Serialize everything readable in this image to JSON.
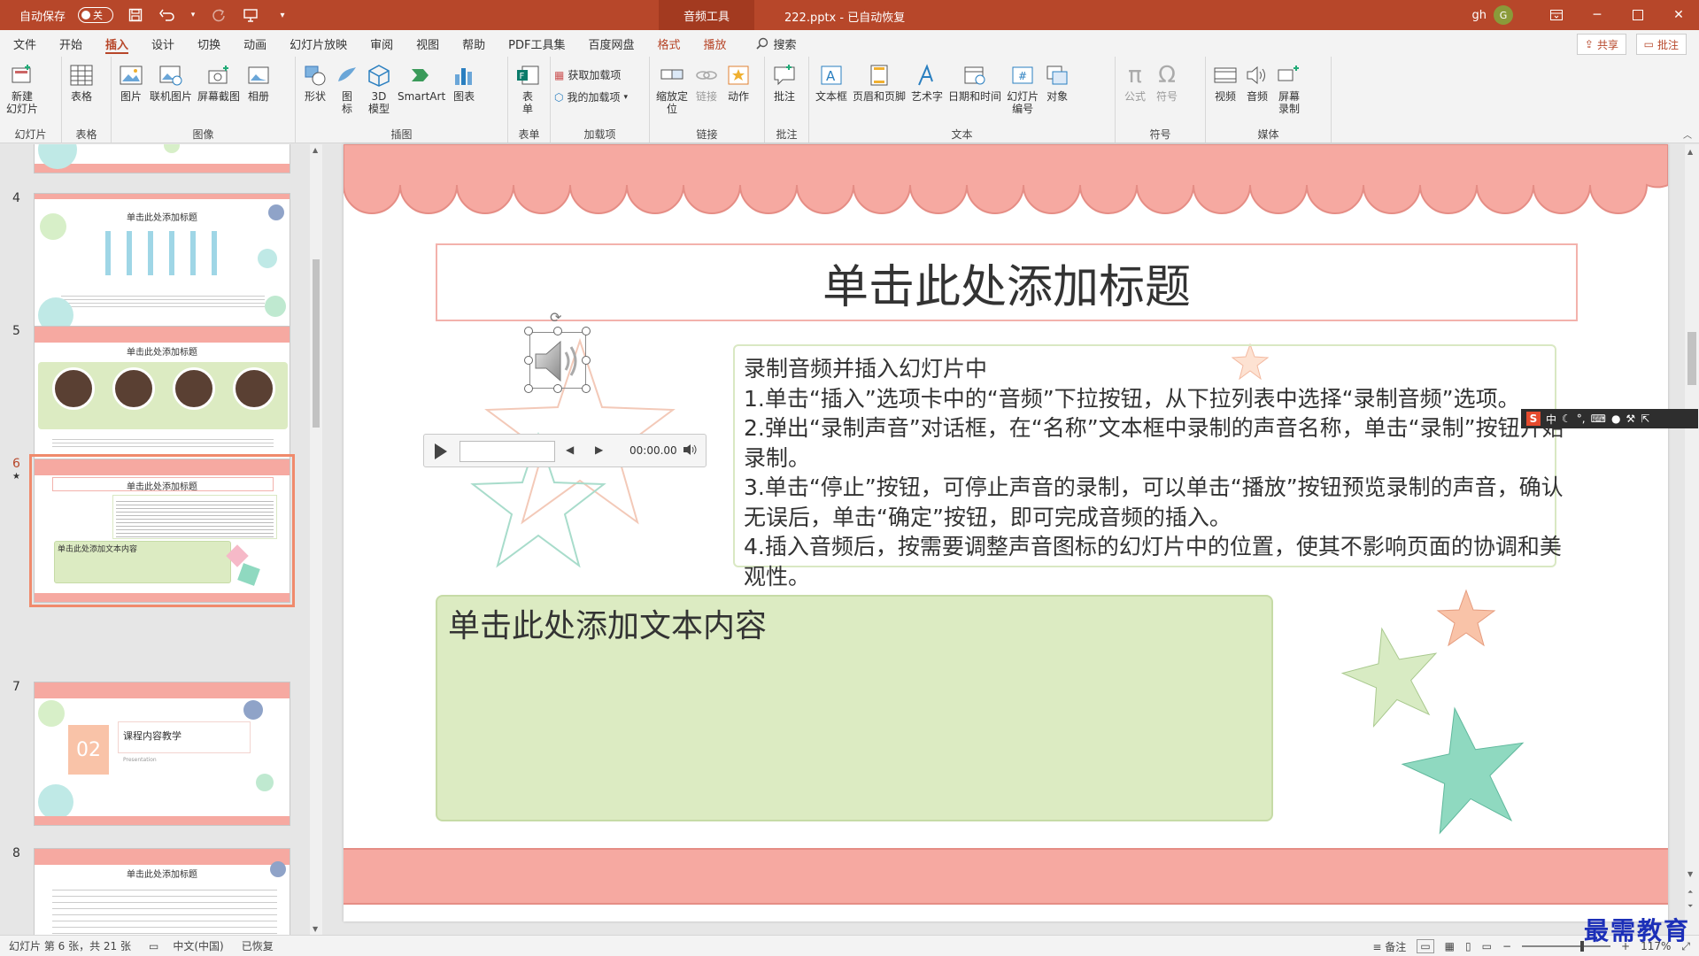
{
  "titlebar": {
    "autosave_label": "自动保存",
    "autosave_state": "关",
    "context_tab": "音频工具",
    "doc_title": "222.pptx  -  已自动恢复",
    "user_name": "gh",
    "user_initial": "G",
    "accent_color": "#b7472a"
  },
  "tabs": [
    {
      "label": "文件"
    },
    {
      "label": "开始"
    },
    {
      "label": "插入",
      "active": true
    },
    {
      "label": "设计"
    },
    {
      "label": "切换"
    },
    {
      "label": "动画"
    },
    {
      "label": "幻灯片放映"
    },
    {
      "label": "审阅"
    },
    {
      "label": "视图"
    },
    {
      "label": "帮助"
    },
    {
      "label": "PDF工具集"
    },
    {
      "label": "百度网盘"
    },
    {
      "label": "格式",
      "context": true
    },
    {
      "label": "播放",
      "context": true
    }
  ],
  "search_label": "搜索",
  "share_label": "共享",
  "comment_label": "批注",
  "ribbon": {
    "groups": {
      "slides": "幻灯片",
      "tables": "表格",
      "images": "图像",
      "illustrations": "插图",
      "forms": "表单",
      "addins": "加载项",
      "links": "链接",
      "comments": "批注",
      "text": "文本",
      "symbols": "符号",
      "media": "媒体"
    },
    "buttons": {
      "new_slide": "新建\n幻灯片",
      "table": "表格",
      "picture": "图片",
      "online_picture": "联机图片",
      "screenshot": "屏幕截图",
      "album": "相册",
      "shapes": "形状",
      "icons": "图\n标",
      "model3d": "3D\n模型",
      "smartart": "SmartArt",
      "chart": "图表",
      "form": "表\n单",
      "get_addins": "获取加载项",
      "my_addins": "我的加载项",
      "zoom": "缩放定\n位",
      "link": "链接",
      "action": "动作",
      "comment": "批注",
      "textbox": "文本框",
      "header_footer": "页眉和页脚",
      "wordart": "艺术字",
      "datetime": "日期和时间",
      "slide_number": "幻灯片\n编号",
      "object": "对象",
      "equation": "公式",
      "symbol": "符号",
      "video": "视频",
      "audio": "音频",
      "screen_recording": "屏幕\n录制"
    }
  },
  "thumbnails": [
    {
      "num": "4",
      "title": "单击此处添加标题"
    },
    {
      "num": "5",
      "title": "单击此处添加标题"
    },
    {
      "num": "6",
      "title": "单击此处添加标题",
      "active": true,
      "mark": "★"
    },
    {
      "num": "7",
      "title": "课程内容教学",
      "badge": "02",
      "sub": "Presentation"
    },
    {
      "num": "8",
      "title": "单击此处添加标题"
    }
  ],
  "slide": {
    "title": "单击此处添加标题",
    "content_lines": [
      "录制音频并插入幻灯片中",
      "1.单击“插入”选项卡中的“音频”下拉按钮，从下拉列表中选择“录制音频”选项。",
      "2.弹出“录制声音”对话框，在“名称”文本框中录制的声音名称，单击“录制”按钮开始录制。",
      "3.单击“停止”按钮，可停止声音的录制，可以单击“播放”按钮预览录制的声音，确认无误后，单击“确定”按钮，即可完成音频的插入。",
      "4.插入音频后，按需要调整声音图标的幻灯片中的位置，使其不影响页面的协调和美观性。"
    ],
    "placeholder_text": "单击此处添加文本内容",
    "media_time": "00:00.00",
    "colors": {
      "pink": "#f6a9a1",
      "green": "#dcebc2",
      "teal_star": "#8fd9c0",
      "orange_star": "#f9c3a8"
    }
  },
  "statusbar": {
    "slide_info": "幻灯片 第 6 张，共 21 张",
    "language": "中文(中国)",
    "accessibility": "已恢复",
    "notes": "备注",
    "zoom": "117%"
  },
  "ime": {
    "lang": "中"
  },
  "watermark": "最需教育"
}
